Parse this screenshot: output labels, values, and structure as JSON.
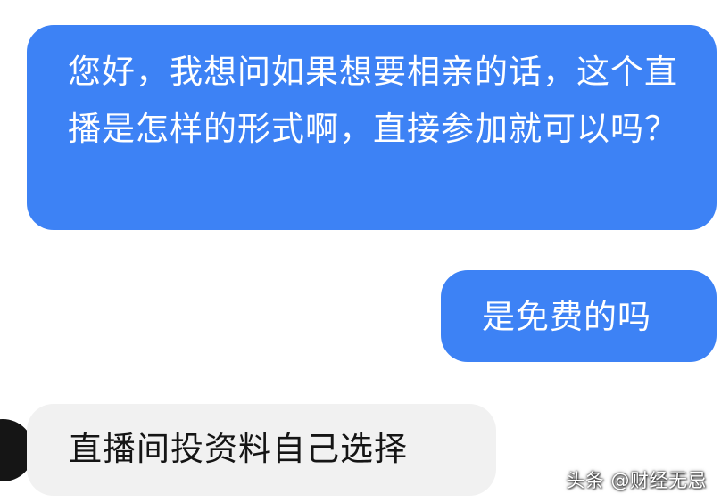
{
  "messages": [
    {
      "side": "outgoing",
      "text": "您好，我想问如果想要相亲的话，这个直播是怎样的形式啊，直接参加就可以吗？"
    },
    {
      "side": "outgoing",
      "text": "是免费的吗"
    },
    {
      "side": "incoming",
      "text": "直播间投资料自己选择"
    }
  ],
  "watermark": "头条 @财经无忌",
  "colors": {
    "outgoing_bubble": "#3d82f5",
    "incoming_bubble": "#f1f1f1",
    "background": "#ffffff"
  }
}
